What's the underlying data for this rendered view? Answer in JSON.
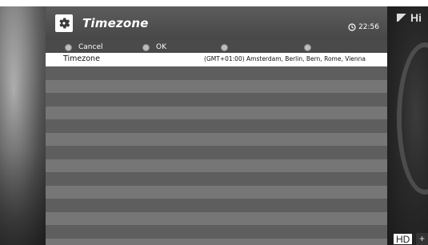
{
  "window": {
    "title": "Timezone",
    "clock": "22:56"
  },
  "actions": [
    {
      "label": "Cancel"
    },
    {
      "label": "OK"
    },
    {
      "label": ""
    },
    {
      "label": ""
    }
  ],
  "list": {
    "selected": {
      "name": "Timezone",
      "value": "(GMT+01:00) Amsterdam, Berlin, Bern, Rome, Vienna"
    }
  },
  "background": {
    "channel_logo": "Hi",
    "hd_tag": "HD",
    "plus_tag": "+"
  },
  "icons": {
    "header": "gear-icon",
    "clock": "clock-icon"
  },
  "colors": {
    "panel": "#4a4a4a",
    "selected_row": "#ffffff",
    "button_dot": "#bdbdbd"
  }
}
